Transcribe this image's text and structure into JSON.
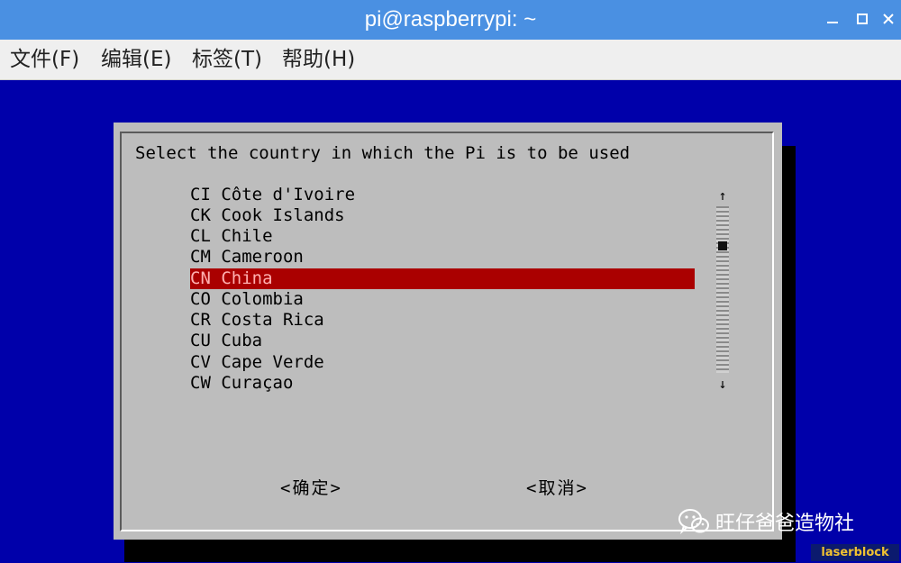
{
  "window": {
    "title": "pi@raspberrypi: ~",
    "controls": [
      "minimize-icon",
      "maximize-icon",
      "close-icon"
    ]
  },
  "menubar": {
    "items": [
      {
        "label": "文件(F)"
      },
      {
        "label": "编辑(E)"
      },
      {
        "label": "标签(T)"
      },
      {
        "label": "帮助(H)"
      }
    ]
  },
  "dialog": {
    "prompt": "Select the country in which the Pi is to be used",
    "items": [
      {
        "label": "CI Côte d'Ivoire"
      },
      {
        "label": "CK Cook Islands"
      },
      {
        "label": "CL Chile"
      },
      {
        "label": "CM Cameroon"
      },
      {
        "label": "CN China",
        "selected": true
      },
      {
        "label": "CO Colombia"
      },
      {
        "label": "CR Costa Rica"
      },
      {
        "label": "CU Cuba"
      },
      {
        "label": "CV Cape Verde"
      },
      {
        "label": "CW Curaçao"
      }
    ],
    "selected_index": 4,
    "scroll": {
      "up_arrow": "↑",
      "down_arrow": "↓",
      "position_fraction": 0.22
    },
    "ok_label": "<确定>",
    "cancel_label": "<取消>"
  },
  "watermark": {
    "text": "旺仔爸爸造物社",
    "icon": "wechat-icon",
    "tag": "laserblock"
  },
  "colors": {
    "terminal_bg": "#0000aa",
    "dialog_bg": "#bdbdbd",
    "selection_bg": "#aa0000",
    "titlebar_bg": "#4a90e2",
    "tag_text": "#f2c230"
  }
}
